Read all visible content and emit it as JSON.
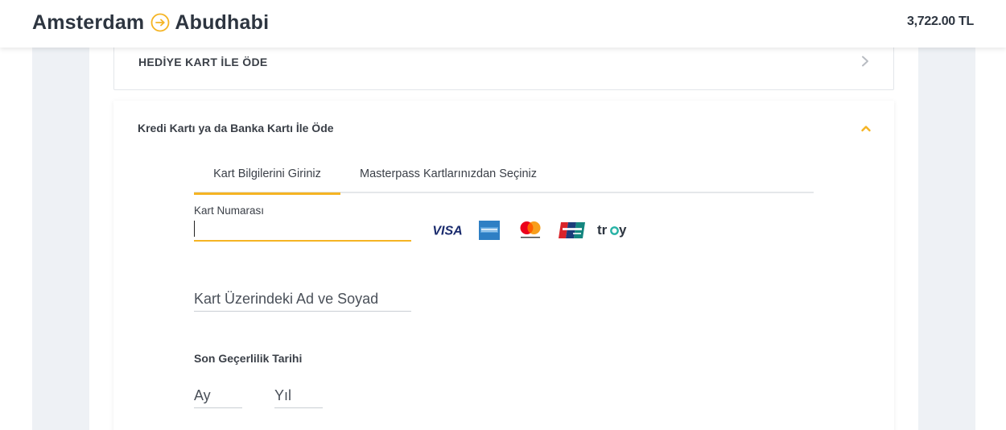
{
  "header": {
    "origin": "Amsterdam",
    "destination": "Abudhabi",
    "route_icon": "arrow-right-circle-icon",
    "price": "3,722.00 TL",
    "accent_color": "#f5b423"
  },
  "gift_card": {
    "title": "HEDİYE KART İLE ÖDE",
    "icon": "chevron-right-icon"
  },
  "card_payment": {
    "title": "Kredi Kartı ya da Banka Kartı İle Öde",
    "icon": "chevron-up-icon",
    "tabs": [
      {
        "label": "Kart Bilgilerini Giriniz",
        "active": true
      },
      {
        "label": "Masterpass Kartlarınızdan Seçiniz",
        "active": false
      }
    ],
    "card_number": {
      "label": "Kart Numarası",
      "value": ""
    },
    "logos": [
      "VISA",
      "AMERICAN EXPRESS",
      "mastercard",
      "UnionPay 银联",
      "troy"
    ],
    "name_on_card": {
      "placeholder": "Kart Üzerindeki Ad ve Soyad",
      "value": ""
    },
    "expiry": {
      "title": "Son Geçerlilik Tarihi",
      "month_placeholder": "Ay",
      "year_placeholder": "Yıl"
    }
  }
}
